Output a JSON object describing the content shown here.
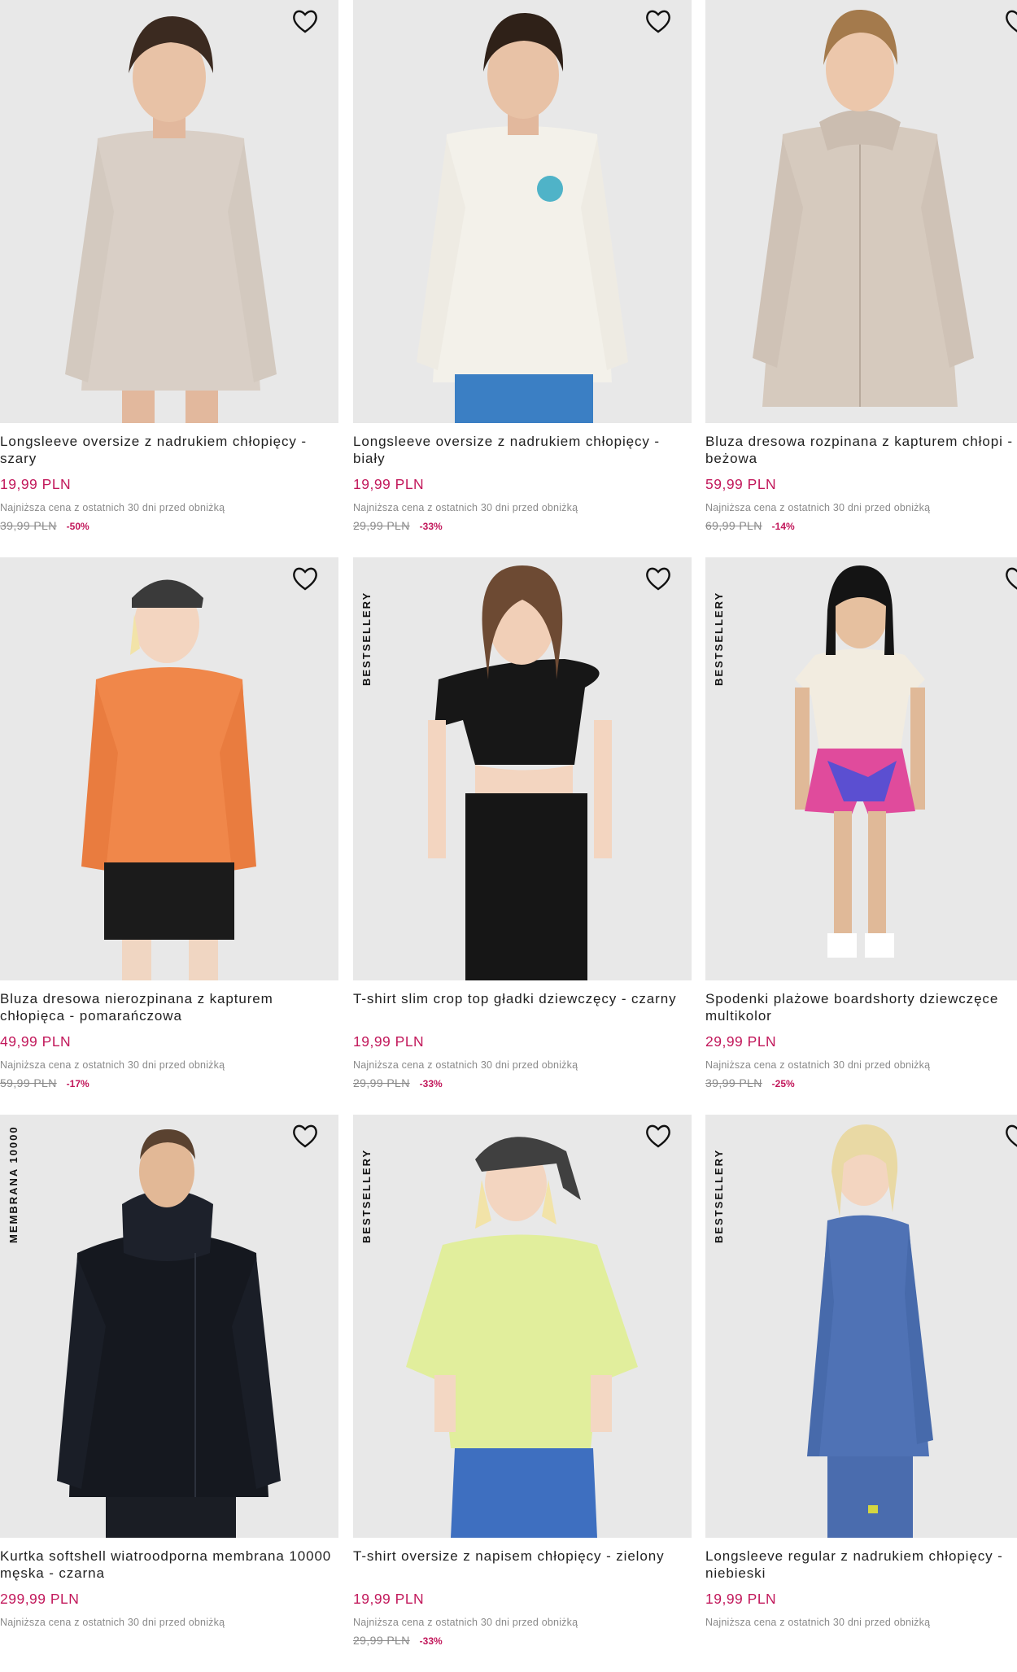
{
  "colors": {
    "price": "#c2185b",
    "muted": "#8a8a8a",
    "image_bg": "#e9e9e9",
    "text": "#222222"
  },
  "icons": {
    "favorite": "heart-outline-icon"
  },
  "lowest_price_note": "Najniższa cena z ostatnich 30 dni przed obniżką",
  "products": [
    {
      "name": "Longsleeve oversize z nadrukiem chłopięcy - szary",
      "price": "19,99 PLN",
      "old_price": "39,99 PLN",
      "discount": "-50%",
      "badge": ""
    },
    {
      "name": "Longsleeve oversize z nadrukiem chłopięcy - biały",
      "price": "19,99 PLN",
      "old_price": "29,99 PLN",
      "discount": "-33%",
      "badge": ""
    },
    {
      "name": "Bluza dresowa rozpinana z kapturem chłopi - beżowa",
      "price": "59,99 PLN",
      "old_price": "69,99 PLN",
      "discount": "-14%",
      "badge": ""
    },
    {
      "name": "Bluza dresowa nierozpinana z kapturem chłopięca - pomarańczowa",
      "price": "49,99 PLN",
      "old_price": "59,99 PLN",
      "discount": "-17%",
      "badge": ""
    },
    {
      "name": "T-shirt slim crop top gładki dziewczęcy - czarny",
      "price": "19,99 PLN",
      "old_price": "29,99 PLN",
      "discount": "-33%",
      "badge": "BESTSELLERY"
    },
    {
      "name": "Spodenki plażowe boardshorty dziewczęce multikolor",
      "price": "29,99 PLN",
      "old_price": "39,99 PLN",
      "discount": "-25%",
      "badge": "BESTSELLERY"
    },
    {
      "name": "Kurtka softshell wiatroodporna membrana 10000 męska - czarna",
      "price": "299,99 PLN",
      "old_price": "",
      "discount": "",
      "badge": "MEMBRANA 10000"
    },
    {
      "name": "T-shirt oversize z napisem chłopięcy - zielony",
      "price": "19,99 PLN",
      "old_price": "29,99 PLN",
      "discount": "-33%",
      "badge": "BESTSELLERY"
    },
    {
      "name": "Longsleeve regular z nadrukiem chłopięcy - niebieski",
      "price": "19,99 PLN",
      "old_price": "",
      "discount": "",
      "badge": "BESTSELLERY"
    }
  ]
}
